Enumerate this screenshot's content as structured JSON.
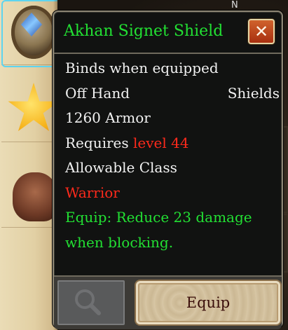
{
  "compass": {
    "north": "N"
  },
  "item": {
    "name": "Akhan Signet Shield",
    "binds": "Binds when equipped",
    "slot": "Off Hand",
    "type": "Shields",
    "armor": "1260 Armor",
    "requires_label": "Requires",
    "requires_value": "level 44",
    "class_label": "Allowable Class",
    "class_value": "Warrior",
    "equip_line1": "Equip: Reduce 23 damage",
    "equip_line2": "when blocking."
  },
  "buttons": {
    "close_icon": "close-icon",
    "inspect_icon": "magnifier-icon",
    "equip_label": "Equip"
  },
  "colors": {
    "item_name": "#22e033",
    "requirement_unmet": "#ff2a1c",
    "equip_effect": "#22e033",
    "panel_bg": "#111211"
  },
  "inventory_slots": [
    {
      "icon": "shield-item-icon",
      "selected": true
    },
    {
      "icon": "star-item-icon",
      "selected": false
    },
    {
      "icon": "creature-item-icon",
      "selected": false
    }
  ]
}
